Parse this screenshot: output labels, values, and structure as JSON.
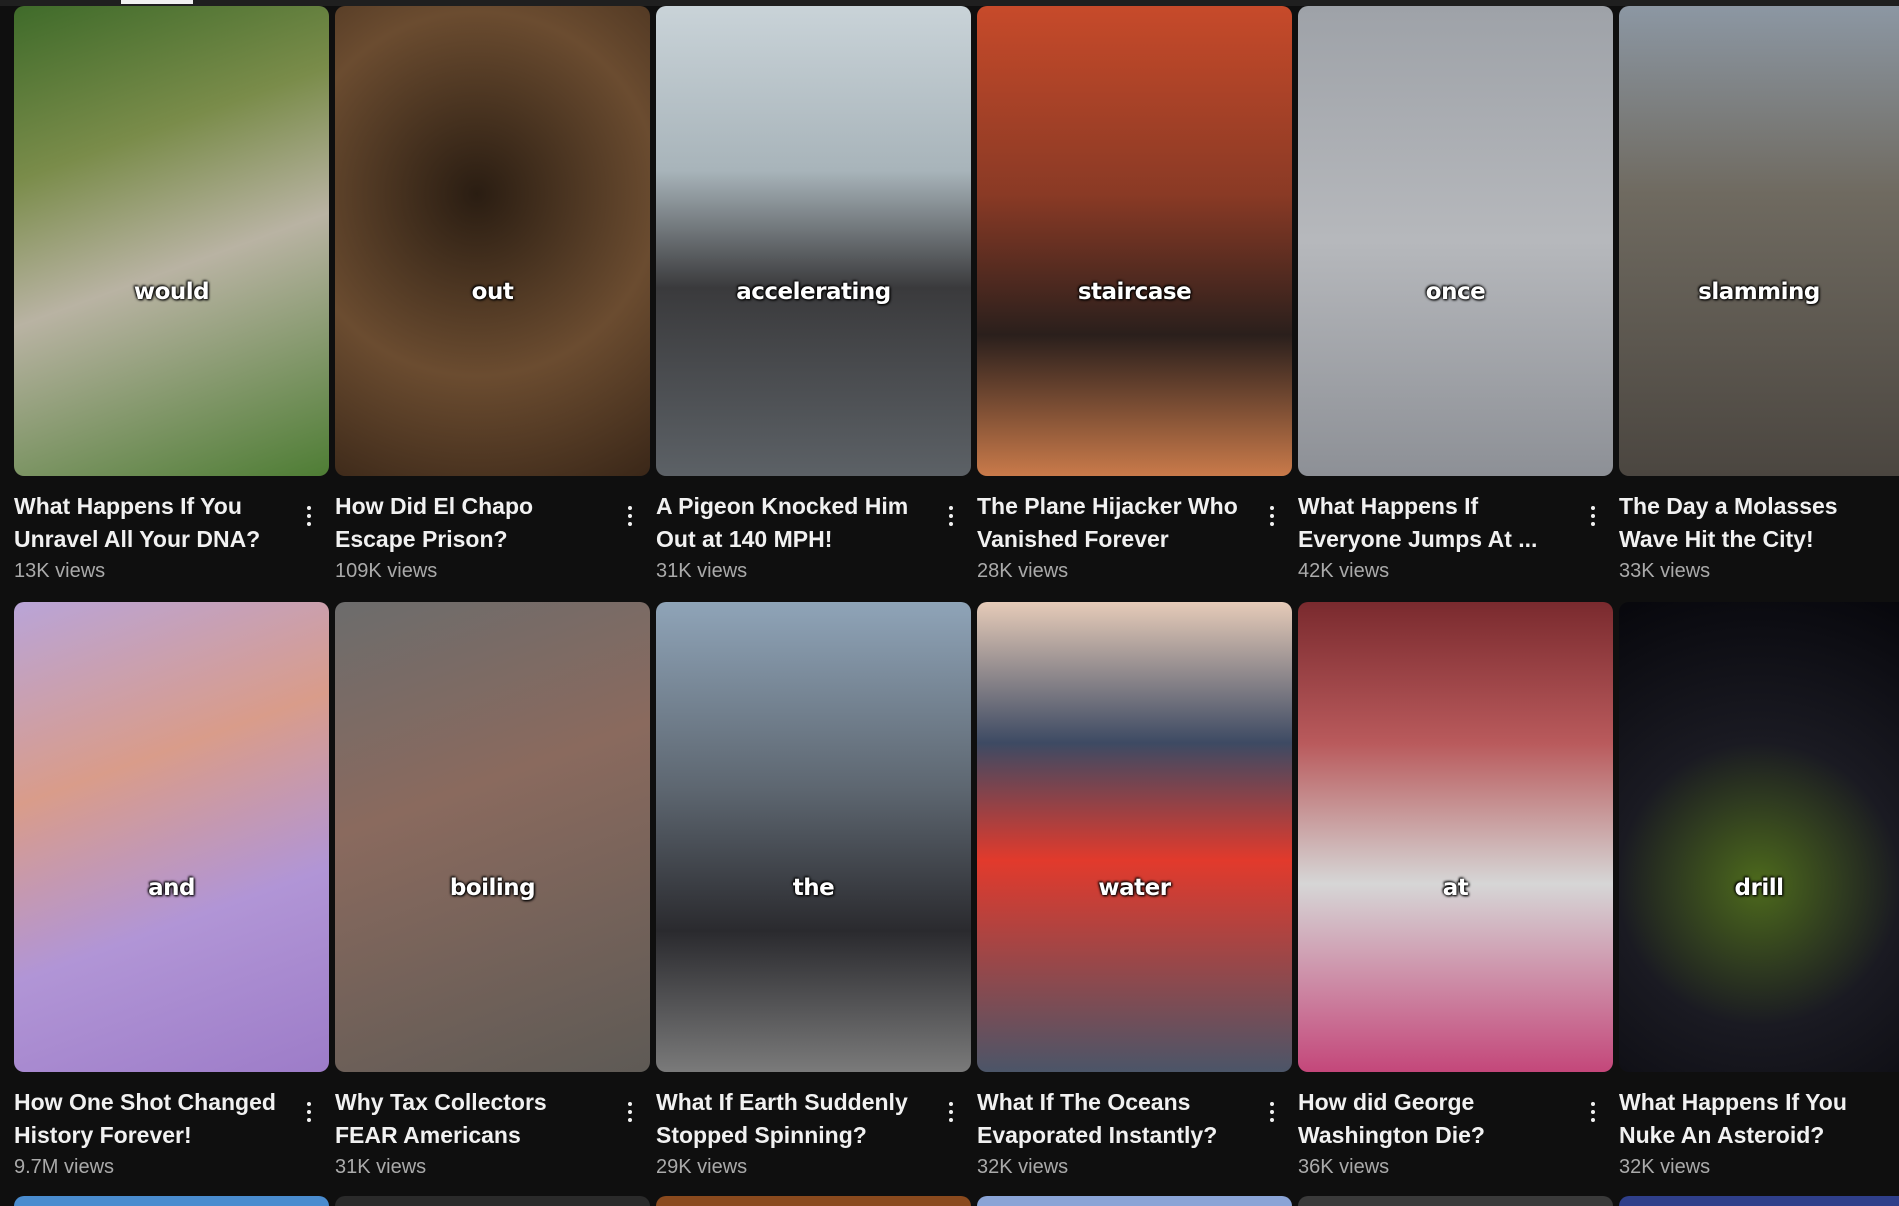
{
  "videos": [
    {
      "title": "What Happens If You Unravel All Your DNA?",
      "views": "13K views",
      "overlay": "would",
      "bg": "linear-gradient(160deg,#3f6b2a 0%,#7a8c4a 30%,#b9b3a3 55%,#4e7d34 100%)"
    },
    {
      "title": "How Did El Chapo Escape Prison?",
      "views": "109K views",
      "overlay": "out",
      "bg": "radial-gradient(circle at 45% 40%,#2a1d12 0%,#6b4c30 55%,#3a2718 100%)"
    },
    {
      "title": "A Pigeon Knocked Him Out at 140 MPH!",
      "views": "31K views",
      "overlay": "accelerating",
      "bg": "linear-gradient(180deg,#c9d3d8 0%,#a8b4ba 35%,#3a3a3c 60%,#5c6166 100%)"
    },
    {
      "title": "The Plane Hijacker Who Vanished Forever",
      "views": "28K views",
      "overlay": "staircase",
      "bg": "linear-gradient(180deg,#c74a2a 0%,#8a3a25 40%,#2a1f1c 70%,#c97a4a 100%)"
    },
    {
      "title": "What Happens If Everyone Jumps At ...",
      "views": "42K views",
      "overlay": "once",
      "bg": "linear-gradient(180deg,#9ea2a8 0%,#b6b8bc 50%,#8d9096 100%)"
    },
    {
      "title": "The Day a Molasses Wave Hit the City!",
      "views": "33K views",
      "overlay": "slamming",
      "bg": "linear-gradient(180deg,#8c97a3 0%,#6f6a60 40%,#4b4640 100%)"
    },
    {
      "title": "How One Shot Changed History Forever!",
      "views": "9.7M views",
      "overlay": "and",
      "bg": "linear-gradient(160deg,#b9a4d8 0%,#d99c8a 35%,#b195d6 65%,#9d7cc8 100%)"
    },
    {
      "title": "Why Tax Collectors FEAR Americans",
      "views": "31K views",
      "overlay": "boiling",
      "bg": "linear-gradient(160deg,#6c6c6c 0%,#8a6a5e 40%,#5e5a55 100%)"
    },
    {
      "title": "What If Earth Suddenly Stopped Spinning?",
      "views": "29K views",
      "overlay": "the",
      "bg": "linear-gradient(180deg,#8fa4b8 0%,#5d6670 40%,#2a2a2e 70%,#7a7a7a 100%)"
    },
    {
      "title": "What If The Oceans Evaporated Instantly?",
      "views": "32K views",
      "overlay": "water",
      "bg": "linear-gradient(180deg,#e6cbb8 0%,#3d4a63 30%,#e23a2c 55%,#4b5568 100%)"
    },
    {
      "title": "How did George Washington Die?",
      "views": "36K views",
      "overlay": "at",
      "bg": "linear-gradient(180deg,#7a2a2e 0%,#b95a5c 30%,#d6d6d6 60%,#c4477a 100%)"
    },
    {
      "title": "What Happens If You Nuke An Asteroid?",
      "views": "32K views",
      "overlay": "drill",
      "bg": "radial-gradient(circle at 50% 60%,#4d6a1c 0%,#1a1a22 45%,#07070c 100%)"
    }
  ],
  "next_row_colors": [
    "#4a8ccf",
    "#2a2a2a",
    "#8a4a1e",
    "#8aa4d6",
    "#3a3a3a",
    "#2f3f8a"
  ]
}
